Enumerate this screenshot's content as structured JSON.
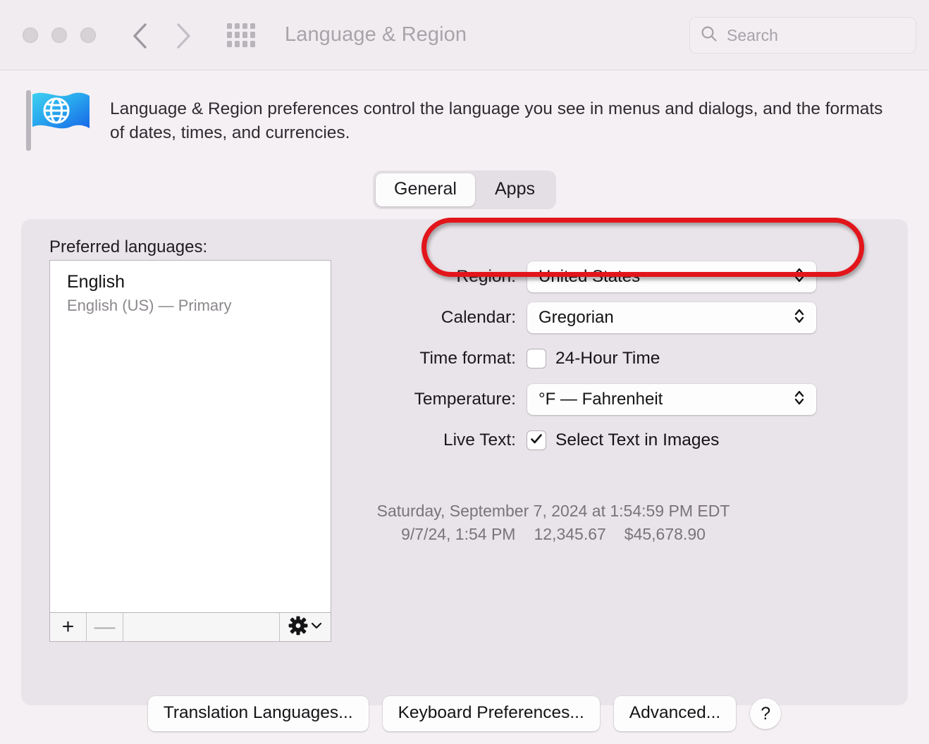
{
  "window": {
    "title": "Language & Region",
    "traffic_lights": [
      "close",
      "minimize",
      "zoom"
    ],
    "back_icon": "chevron-left-icon",
    "forward_icon": "chevron-right-icon",
    "grid_icon": "apps-grid-icon"
  },
  "search": {
    "placeholder": "Search",
    "icon": "search-icon",
    "value": ""
  },
  "header": {
    "icon": "waving-flag-globe-icon",
    "description": "Language & Region preferences control the language you see in menus and dialogs, and the formats of dates, times, and currencies."
  },
  "tabs": [
    {
      "label": "General",
      "selected": true
    },
    {
      "label": "Apps",
      "selected": false
    }
  ],
  "languages": {
    "section_label": "Preferred languages:",
    "items": [
      {
        "name": "English",
        "detail": "English (US) — Primary"
      }
    ],
    "toolbar": {
      "add_label": "+",
      "remove_label": "—",
      "gear_icon": "gear-icon",
      "gear_chevron_icon": "chevron-down-icon"
    }
  },
  "form": {
    "region": {
      "label": "Region:",
      "value": "United States",
      "control": "popup-button"
    },
    "calendar": {
      "label": "Calendar:",
      "value": "Gregorian",
      "control": "popup-button"
    },
    "time_format": {
      "label": "Time format:",
      "checkbox_label": "24-Hour Time",
      "checked": false
    },
    "temperature": {
      "label": "Temperature:",
      "value": "°F — Fahrenheit",
      "control": "popup-button"
    },
    "live_text": {
      "label": "Live Text:",
      "checkbox_label": "Select Text in Images",
      "checked": true
    }
  },
  "preview": {
    "long_date": "Saturday, September 7, 2024 at 1:54:59 PM EDT",
    "short_date": "9/7/24, 1:54 PM",
    "number": "12,345.67",
    "currency": "$45,678.90"
  },
  "bottom_buttons": [
    {
      "label": "Translation Languages..."
    },
    {
      "label": "Keyboard Preferences..."
    },
    {
      "label": "Advanced..."
    }
  ],
  "help_button": {
    "label": "?"
  },
  "annotation": {
    "target": "region-row",
    "color": "#e2151b",
    "shape": "ellipse-outline"
  },
  "colors": {
    "window_bg": "#f4f0f3",
    "panel_bg": "#e9e4e9",
    "titlebar_bg": "#f0ecef",
    "accent_red": "#e2151b",
    "text_primary": "#1b191d",
    "text_secondary": "#79747a"
  }
}
